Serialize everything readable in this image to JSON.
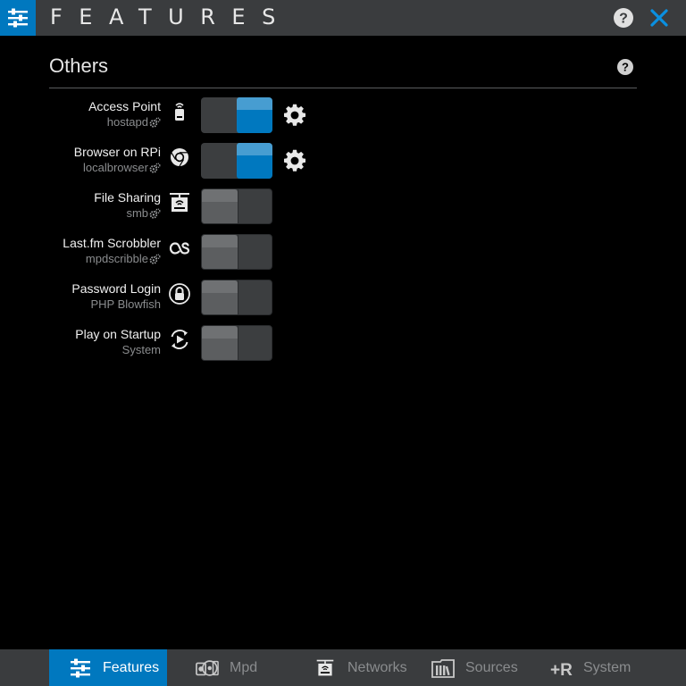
{
  "window": {
    "title": "FEATURES",
    "menu_icon": "sliders-icon",
    "help_icon": "question-circle-icon",
    "close_icon": "close-icon"
  },
  "section": {
    "title": "Others",
    "help_icon": "question-circle-icon"
  },
  "features": [
    {
      "name": "Access Point",
      "sub": "hostapd",
      "sub_has_cog": true,
      "icon": "access-point-icon",
      "enabled": true,
      "has_settings": true
    },
    {
      "name": "Browser on RPi",
      "sub": "localbrowser",
      "sub_has_cog": true,
      "icon": "chromium-icon",
      "enabled": true,
      "has_settings": true
    },
    {
      "name": "File Sharing",
      "sub": "smb",
      "sub_has_cog": true,
      "icon": "network-drive-icon",
      "enabled": false,
      "has_settings": false
    },
    {
      "name": "Last.fm Scrobbler",
      "sub": "mpdscribble",
      "sub_has_cog": true,
      "icon": "lastfm-icon",
      "enabled": false,
      "has_settings": false
    },
    {
      "name": "Password Login",
      "sub": "PHP Blowfish",
      "sub_has_cog": false,
      "icon": "lock-icon",
      "enabled": false,
      "has_settings": false
    },
    {
      "name": "Play on Startup",
      "sub": "System",
      "sub_has_cog": false,
      "icon": "play-refresh-icon",
      "enabled": false,
      "has_settings": false
    }
  ],
  "tabs": [
    {
      "label": "Features",
      "icon": "sliders-icon",
      "active": true
    },
    {
      "label": "Mpd",
      "icon": "mpd-icon",
      "active": false
    },
    {
      "label": "Networks",
      "icon": "network-drive-icon",
      "active": false
    },
    {
      "label": "Sources",
      "icon": "library-icon",
      "active": false
    },
    {
      "label": "System",
      "icon": "raspberry-icon",
      "active": false
    }
  ],
  "colors": {
    "accent": "#0078bf",
    "bar": "#3a3c3e",
    "background": "#000000",
    "muted_text": "#8a8c8e"
  }
}
